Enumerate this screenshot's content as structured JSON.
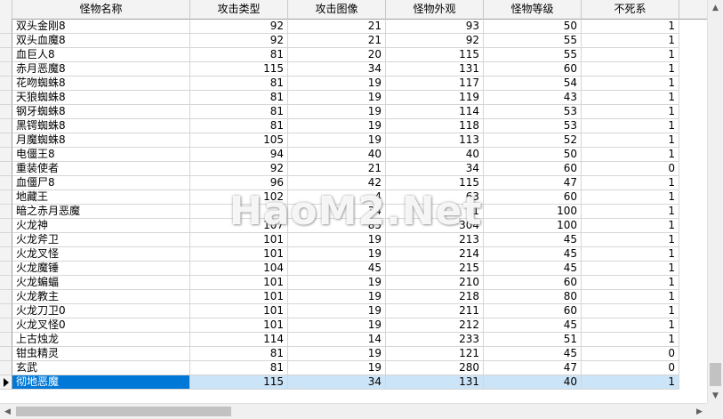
{
  "columns": [
    "怪物名称",
    "攻击类型",
    "攻击图像",
    "怪物外观",
    "怪物等级",
    "不死系"
  ],
  "rows": [
    [
      "双头金刚8",
      "92",
      "21",
      "93",
      "50",
      "1"
    ],
    [
      "双头血魔8",
      "92",
      "21",
      "92",
      "55",
      "1"
    ],
    [
      "血巨人8",
      "81",
      "20",
      "115",
      "55",
      "1"
    ],
    [
      "赤月恶魔8",
      "115",
      "34",
      "131",
      "60",
      "1"
    ],
    [
      "花吻蜘蛛8",
      "81",
      "19",
      "117",
      "54",
      "1"
    ],
    [
      "天狼蜘蛛8",
      "81",
      "19",
      "119",
      "43",
      "1"
    ],
    [
      "钢牙蜘蛛8",
      "81",
      "19",
      "114",
      "53",
      "1"
    ],
    [
      "黑锷蜘蛛8",
      "81",
      "19",
      "118",
      "53",
      "1"
    ],
    [
      "月魔蜘蛛8",
      "105",
      "19",
      "113",
      "52",
      "1"
    ],
    [
      "电僵王8",
      "94",
      "40",
      "40",
      "50",
      "1"
    ],
    [
      "重装使者",
      "92",
      "21",
      "34",
      "60",
      "0"
    ],
    [
      "血僵尸8",
      "96",
      "42",
      "115",
      "47",
      "1"
    ],
    [
      "地藏王",
      "102",
      "4",
      "63",
      "60",
      "1"
    ],
    [
      "暗之赤月恶魔",
      "",
      "34",
      "1",
      "100",
      "1"
    ],
    [
      "火龙神",
      "107",
      "85",
      "304",
      "100",
      "1"
    ],
    [
      "火龙斧卫",
      "101",
      "19",
      "213",
      "45",
      "1"
    ],
    [
      "火龙叉怪",
      "101",
      "19",
      "214",
      "45",
      "1"
    ],
    [
      "火龙魔锤",
      "104",
      "45",
      "215",
      "45",
      "1"
    ],
    [
      "火龙蝙蝠",
      "101",
      "19",
      "210",
      "60",
      "1"
    ],
    [
      "火龙教主",
      "101",
      "19",
      "218",
      "80",
      "1"
    ],
    [
      "火龙刀卫0",
      "101",
      "19",
      "211",
      "60",
      "1"
    ],
    [
      "火龙叉怪0",
      "101",
      "19",
      "212",
      "45",
      "1"
    ],
    [
      "上古烛龙",
      "114",
      "14",
      "233",
      "51",
      "1"
    ],
    [
      "钳虫精灵",
      "81",
      "19",
      "121",
      "45",
      "0"
    ],
    [
      "玄武",
      "81",
      "19",
      "280",
      "47",
      "0"
    ],
    [
      "彻地恶魔",
      "115",
      "34",
      "131",
      "40",
      "1"
    ]
  ],
  "selected_row_index": 25,
  "watermark": "HaoM2.Net",
  "colors": {
    "header_bg": "#f3f3f3",
    "selected_row_bg": "#cce4f7",
    "selected_cell_bg": "#0078d7",
    "grid_line": "#d6d6d6"
  }
}
